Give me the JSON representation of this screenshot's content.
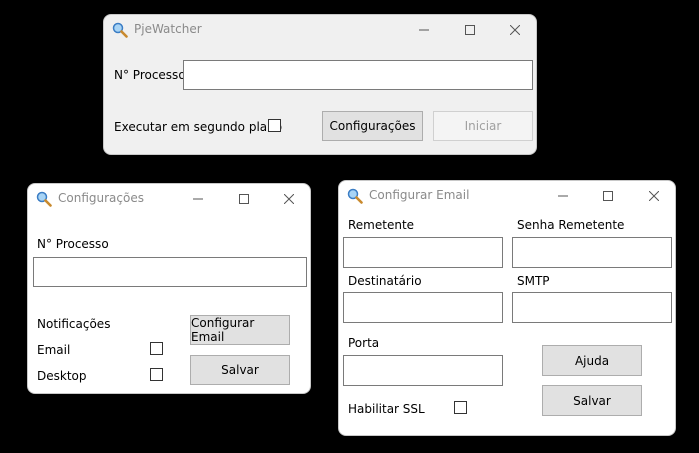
{
  "main_window": {
    "title": "PjeWatcher",
    "processo_label": "N° Processo",
    "processo_value": "",
    "background_label": "Executar em segundo plano",
    "config_button": "Configurações",
    "start_button": "Iniciar"
  },
  "config_window": {
    "title": "Configurações",
    "processo_label": "N° Processo",
    "processo_value": "",
    "notifications_label": "Notificações",
    "email_label": "Email",
    "desktop_label": "Desktop",
    "config_email_button": "Configurar Email",
    "save_button": "Salvar"
  },
  "email_window": {
    "title": "Configurar Email",
    "sender_label": "Remetente",
    "sender_password_label": "Senha Remetente",
    "recipient_label": "Destinatário",
    "smtp_label": "SMTP",
    "port_label": "Porta",
    "ssl_label": "Habilitar SSL",
    "help_button": "Ajuda",
    "save_button": "Salvar"
  },
  "icons": {
    "app": "magnifier-icon",
    "minimize": "minimize-icon",
    "maximize": "maximize-icon",
    "close": "close-icon"
  }
}
